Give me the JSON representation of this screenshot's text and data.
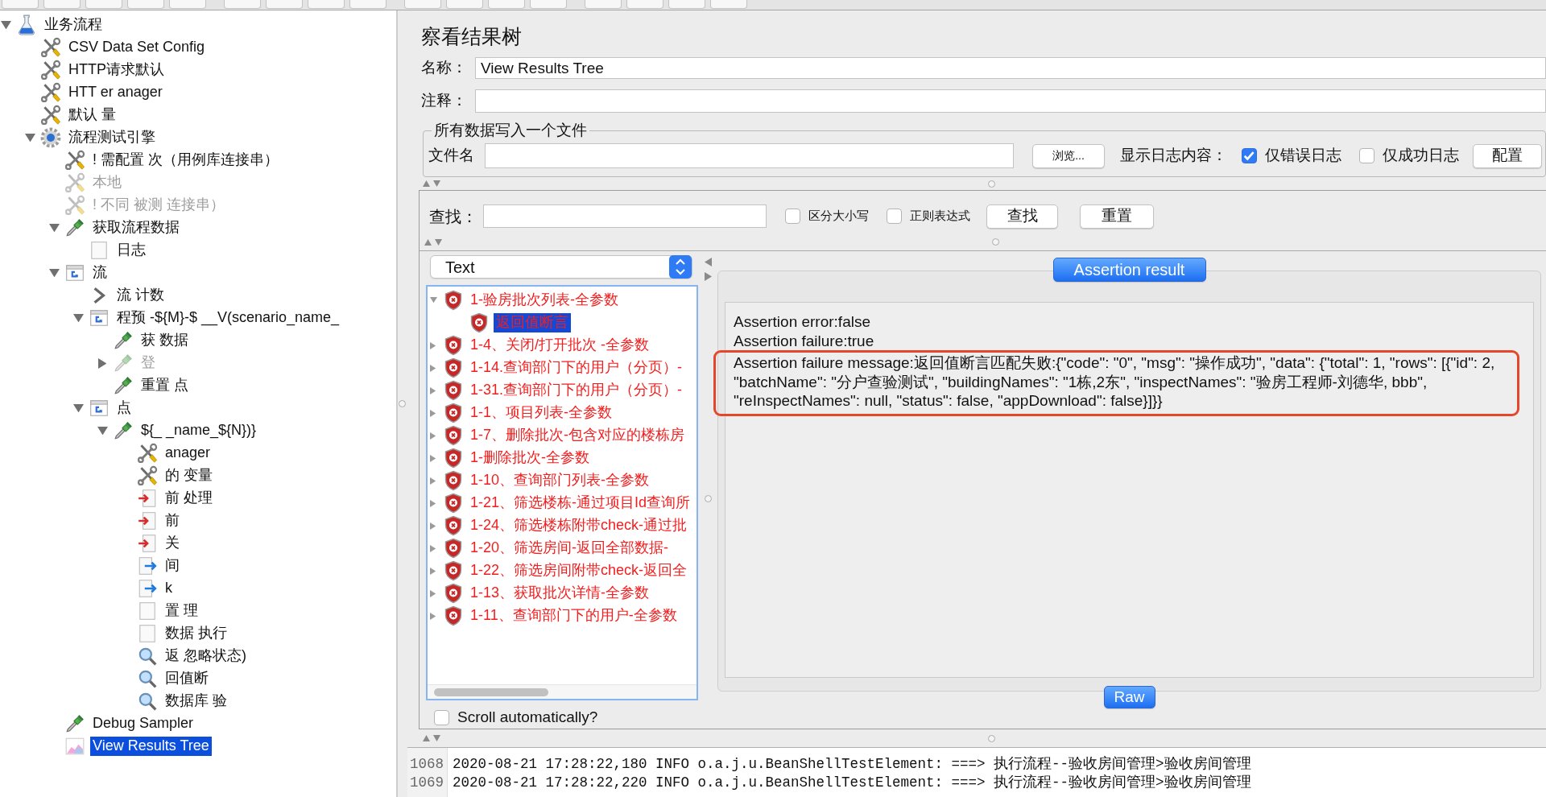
{
  "test_plan_tree": [
    {
      "text": "业务流程",
      "kind": "testplan",
      "selected": false,
      "disabled": false,
      "expanded": true,
      "children": [
        {
          "text": "CSV Data Set Config",
          "kind": "config",
          "selected": false,
          "disabled": false
        },
        {
          "text": "HTTP请求默认",
          "kind": "config",
          "selected": false,
          "disabled": false
        },
        {
          "text": "HTT er anager",
          "kind": "config",
          "selected": false,
          "disabled": false
        },
        {
          "text": "默认 量",
          "kind": "config",
          "selected": false,
          "disabled": false
        },
        {
          "text": "流程测试引擎",
          "kind": "threadgroup",
          "selected": false,
          "disabled": false,
          "expanded": true,
          "children": [
            {
              "text": "! 需配置 次（用例库连接串）",
              "kind": "config",
              "selected": false,
              "disabled": false
            },
            {
              "text": "本地",
              "kind": "config",
              "selected": false,
              "disabled": true
            },
            {
              "text": "! 不同 被测 连接串）",
              "kind": "config",
              "selected": false,
              "disabled": true
            },
            {
              "text": "获取流程数据",
              "kind": "sampler",
              "selected": false,
              "disabled": false,
              "expanded": true,
              "children": [
                {
                  "text": "日志",
                  "kind": "other",
                  "selected": false,
                  "disabled": false
                }
              ]
            },
            {
              "text": "流",
              "kind": "controller",
              "selected": false,
              "disabled": false,
              "expanded": true,
              "children": [
                {
                  "text": "流 计数",
                  "kind": "counter",
                  "selected": false,
                  "disabled": false
                },
                {
                  "text": "程预 -${M}-$ __V(scenario_name_",
                  "kind": "controller",
                  "selected": false,
                  "disabled": false,
                  "expanded": true,
                  "children": [
                    {
                      "text": "获 数据",
                      "kind": "sampler",
                      "selected": false,
                      "disabled": false
                    },
                    {
                      "text": "登",
                      "kind": "sampler",
                      "selected": false,
                      "disabled": true,
                      "expanded": false
                    },
                    {
                      "text": "重置 点",
                      "kind": "sampler",
                      "selected": false,
                      "disabled": false
                    }
                  ]
                },
                {
                  "text": "点",
                  "kind": "controller",
                  "selected": false,
                  "disabled": false,
                  "expanded": true,
                  "children": [
                    {
                      "text": "${_ _name_${N})}",
                      "kind": "sampler",
                      "selected": false,
                      "disabled": false,
                      "expanded": true,
                      "children": [
                        {
                          "text": "anager",
                          "kind": "config",
                          "selected": false,
                          "disabled": false
                        },
                        {
                          "text": "的 变量",
                          "kind": "config",
                          "selected": false,
                          "disabled": false
                        },
                        {
                          "text": "前 处理",
                          "kind": "preprocessor",
                          "selected": false,
                          "disabled": false
                        },
                        {
                          "text": "前",
                          "kind": "preprocessor",
                          "selected": false,
                          "disabled": false
                        },
                        {
                          "text": "关",
                          "kind": "preprocessor",
                          "selected": false,
                          "disabled": false
                        },
                        {
                          "text": "间",
                          "kind": "postprocessor",
                          "selected": false,
                          "disabled": false
                        },
                        {
                          "text": "k",
                          "kind": "postprocessor",
                          "selected": false,
                          "disabled": false
                        },
                        {
                          "text": "置 理",
                          "kind": "other",
                          "selected": false,
                          "disabled": false
                        },
                        {
                          "text": "数据 执行",
                          "kind": "other",
                          "selected": false,
                          "disabled": false
                        },
                        {
                          "text": "返 忽略状态)",
                          "kind": "assertion",
                          "selected": false,
                          "disabled": false
                        },
                        {
                          "text": "回值断",
                          "kind": "assertion",
                          "selected": false,
                          "disabled": false
                        },
                        {
                          "text": "数据库 验",
                          "kind": "assertion",
                          "selected": false,
                          "disabled": false
                        }
                      ]
                    }
                  ]
                }
              ]
            },
            {
              "text": "Debug Sampler",
              "kind": "sampler",
              "selected": false,
              "disabled": false
            },
            {
              "text": "View Results Tree",
              "kind": "listener",
              "selected": true,
              "disabled": false
            }
          ]
        }
      ]
    }
  ],
  "panel": {
    "title": "察看结果树",
    "name_label": "名称：",
    "name_value": "View Results Tree",
    "comment_label": "注释：",
    "file_group": {
      "legend": "所有数据写入一个文件",
      "filename_label": "文件名",
      "browse_button": "浏览...",
      "log_label": "显示日志内容：",
      "options": [
        {
          "label": "仅错误日志",
          "checked": true
        },
        {
          "label": "仅成功日志",
          "checked": false
        }
      ],
      "config_button": "配置"
    },
    "search": {
      "label": "查找：",
      "options": [
        {
          "label": "区分大小写",
          "checked": false
        },
        {
          "label": "正则表达式",
          "checked": false
        }
      ],
      "find_button": "查找",
      "reset_button": "重置"
    },
    "renderer": {
      "value": "Text"
    },
    "results": [
      {
        "text": "1-验房批次列表-全参数",
        "selected": false,
        "expanded": true,
        "children": [
          {
            "text": "返回值断言",
            "selected": true
          }
        ]
      },
      {
        "text": "1-4、关闭/打开批次 -全参数",
        "selected": false,
        "expanded": false
      },
      {
        "text": "1-14.查询部门下的用户（分页）-",
        "selected": false,
        "expanded": false
      },
      {
        "text": "1-31.查询部门下的用户（分页）-",
        "selected": false,
        "expanded": false
      },
      {
        "text": "1-1、项目列表-全参数",
        "selected": false,
        "expanded": false
      },
      {
        "text": "1-7、删除批次-包含对应的楼栋房",
        "selected": false,
        "expanded": false
      },
      {
        "text": "1-删除批次-全参数",
        "selected": false,
        "expanded": false
      },
      {
        "text": "1-10、查询部门列表-全参数",
        "selected": false,
        "expanded": false
      },
      {
        "text": "1-21、筛选楼栋-通过项目Id查询所",
        "selected": false,
        "expanded": false
      },
      {
        "text": "1-24、筛选楼栋附带check-通过批",
        "selected": false,
        "expanded": false
      },
      {
        "text": "1-20、筛选房间-返回全部数据-",
        "selected": false,
        "expanded": false
      },
      {
        "text": "1-22、筛选房间附带check-返回全",
        "selected": false,
        "expanded": false
      },
      {
        "text": "1-13、获取批次详情-全参数",
        "selected": false,
        "expanded": false
      },
      {
        "text": "1-11、查询部门下的用户-全参数",
        "selected": false,
        "expanded": false
      }
    ],
    "scroll_automatically": {
      "label": "Scroll automatically?",
      "checked": false
    },
    "viewer": {
      "tabs": [
        {
          "label": "Assertion result",
          "selected": true
        }
      ],
      "lines": [
        "Assertion error:false",
        "Assertion failure:true"
      ],
      "message": {
        "text": "Assertion failure message:返回值断言匹配失败:{\"code\": \"0\", \"msg\": \"操作成功\", \"data\": {\"total\": 1, \"rows\": [{\"id\": 2, \"batchName\": \"分户查验测试\", \"buildingNames\": \"1栋,2东\", \"inspectNames\": \"验房工程师-刘德华, bbb\", \"reInspectNames\": null, \"status\": false, \"appDownload\": false}]}}",
        "highlighted": true
      },
      "view_modes": [
        {
          "label": "Raw",
          "selected": true
        }
      ]
    }
  },
  "log": {
    "lines": [
      {
        "number": "1068",
        "text": "2020-08-21 17:28:22,180 INFO o.a.j.u.BeanShellTestElement: ===> 执行流程--验收房间管理>验收房间管理"
      },
      {
        "number": "1069",
        "text": "2020-08-21 17:28:22,220 INFO o.a.j.u.BeanShellTestElement: ===> 执行流程--验收房间管理>验收房间管理"
      }
    ]
  }
}
